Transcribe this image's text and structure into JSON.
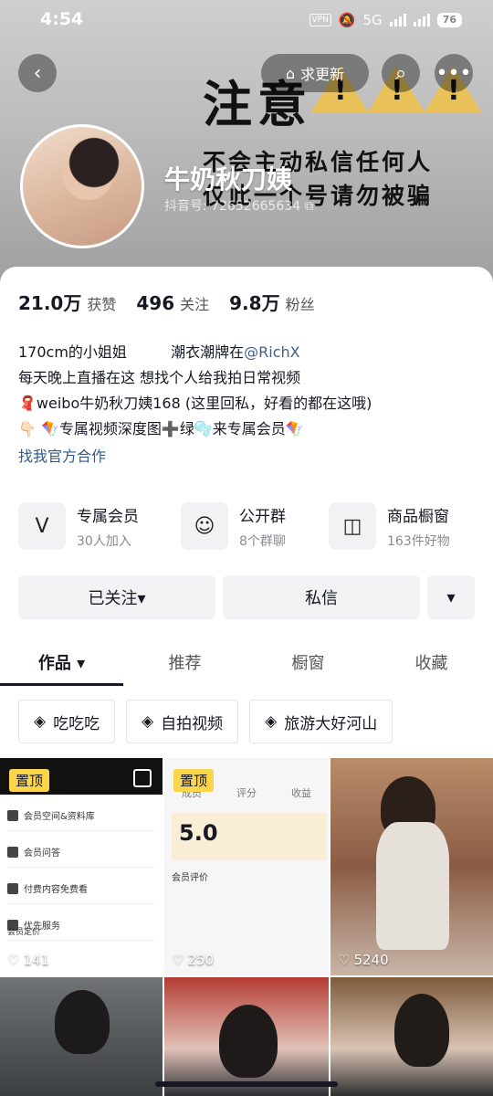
{
  "status": {
    "time": "4:54",
    "vpn": "VPN",
    "network": "5G",
    "battery": "76"
  },
  "header": {
    "request_update_label": "求更新",
    "banner_title": "注意",
    "banner_line1": "不会主动私信任何人",
    "banner_line2": "仅此一个号请勿被骗",
    "name": "牛奶秋刀姨",
    "douyin_id": "抖音号: 72652665634"
  },
  "stats": [
    {
      "value": "21.0万",
      "label": "获赞"
    },
    {
      "value": "496",
      "label": "关注"
    },
    {
      "value": "9.8万",
      "label": "粉丝"
    }
  ],
  "bio": {
    "line1_a": "170cm的小姐姐",
    "line1_b": "潮衣潮牌在",
    "line1_mention": "@RichX",
    "line2": "每天晚上直播在这      想找个人给我拍日常视频",
    "line3": "🧣weibo牛奶秋刀姨168 (这里回私，好看的都在这哦)",
    "line4": "👇🏻 🪁专属视频深度图➕绿🫧来专属会员🪁",
    "link": "找我官方合作"
  },
  "features": [
    {
      "title": "专属会员",
      "sub": "30人加入",
      "icon": "V"
    },
    {
      "title": "公开群",
      "sub": "8个群聊",
      "icon": "☺"
    },
    {
      "title": "商品橱窗",
      "sub": "163件好物",
      "icon": "◫"
    }
  ],
  "actions": {
    "following": "已关注▾",
    "message": "私信",
    "more": "▾"
  },
  "tabs": [
    "作品 ▾",
    "推荐",
    "橱窗",
    "收藏"
  ],
  "chips": [
    "吃吃吃",
    "自拍视频",
    "旅游大好河山"
  ],
  "posts": [
    {
      "pinned": "置顶",
      "likes": "141"
    },
    {
      "pinned": "置顶",
      "likes": "250"
    },
    {
      "pinned": "",
      "likes": "5240"
    }
  ],
  "thumb_text": {
    "t1_rows": [
      "会员空间&资料库",
      "会员问答",
      "付费内容免费看",
      "优先服务"
    ],
    "t1_footer": "会员定价",
    "t2_tabs": [
      "成员",
      "评分",
      "收益"
    ],
    "t2_score": "5.0",
    "t2_section": "会员评价"
  }
}
